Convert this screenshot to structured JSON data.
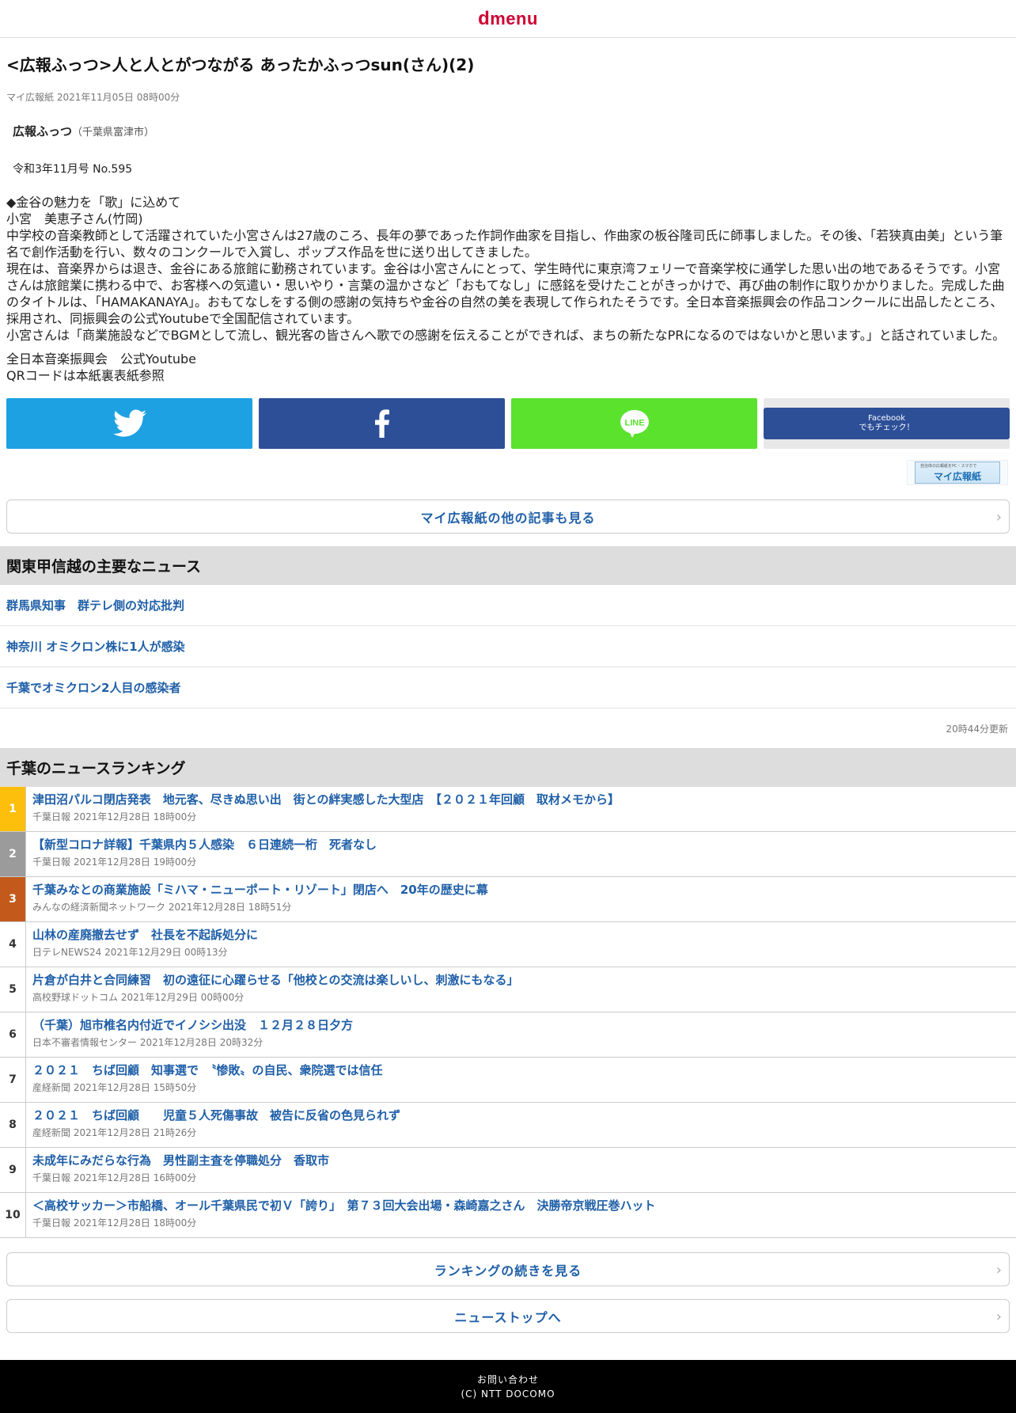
{
  "header": {
    "logo_d": "d",
    "logo_text": "menu"
  },
  "article": {
    "title": "<広報ふっつ>人と人とがつながる あったかふっつsun(さん)(2)",
    "meta": "マイ広報紙 2021年11月05日 08時00分",
    "source_name": "広報ふっつ",
    "source_place": "（千葉県富津市）",
    "issue": "令和3年11月号 No.595",
    "paragraphs": [
      "◆金谷の魅力を「歌」に込めて",
      "小宮　美恵子さん(竹岡)",
      "中学校の音楽教師として活躍されていた小宮さんは27歳のころ、長年の夢であった作詞作曲家を目指し、作曲家の板谷隆司氏に師事しました。その後、「若狭真由美」という筆名で創作活動を行い、数々のコンクールで入賞し、ポップス作品を世に送り出してきました。",
      "現在は、音楽界からは退き、金谷にある旅館に勤務されています。金谷は小宮さんにとって、学生時代に東京湾フェリーで音楽学校に通学した思い出の地であるそうです。小宮さんは旅館業に携わる中で、お客様への気遣い・思いやり・言葉の温かさなど「おもてなし」に感銘を受けたことがきっかけで、再び曲の制作に取りかかりました。完成した曲のタイトルは、「HAMAKANAYA」。おもてなしをする側の感謝の気持ちや金谷の自然の美を表現して作られたそうです。全日本音楽振興会の作品コンクールに出品したところ、採用され、同振興会の公式Youtubeで全国配信されています。",
      "小宮さんは「商業施設などでBGMとして流し、観光客の皆さんへ歌での感謝を伝えることができれば、まちの新たなPRになるのではないかと思います。」と話されていました。"
    ],
    "footer_lines": [
      "全日本音楽振興会　公式Youtube",
      "QRコードは本紙裏表紙参照"
    ]
  },
  "share": {
    "twitter_icon": "twitter-bird-icon",
    "facebook_icon": "facebook-f-icon",
    "line_label": "LINE",
    "fb_check_line1": "Facebook",
    "fb_check_line2": "でもチェック！"
  },
  "banner": {
    "tiny": "自治体の広報紙をPC・スマホで",
    "label": "マイ広報紙"
  },
  "more_button": "マイ広報紙の他の記事も見る",
  "regional": {
    "heading": "関東甲信越の主要なニュース",
    "items": [
      "群馬県知事　群テレ側の対応批判",
      "神奈川 オミクロン株に1人が感染",
      "千葉でオミクロン2人目の感染者"
    ],
    "updated": "20時44分更新"
  },
  "ranking": {
    "heading": "千葉のニュースランキング",
    "items": [
      {
        "rank": "1",
        "title": "津田沼パルコ閉店発表　地元客、尽きぬ思い出　街との絆実感した大型店　【２０２１年回顧　取材メモから】",
        "source": "千葉日報 2021年12月28日 18時00分"
      },
      {
        "rank": "2",
        "title": "【新型コロナ詳報】千葉県内５人感染　６日連続一桁　死者なし",
        "source": "千葉日報 2021年12月28日 19時00分"
      },
      {
        "rank": "3",
        "title": "千葉みなとの商業施設「ミハマ・ニューポート・リゾート」閉店へ　20年の歴史に幕",
        "source": "みんなの経済新聞ネットワーク 2021年12月28日 18時51分"
      },
      {
        "rank": "4",
        "title": "山林の産廃撤去せず　社長を不起訴処分に",
        "source": "日テレNEWS24 2021年12月29日 00時13分"
      },
      {
        "rank": "5",
        "title": "片倉が白井と合同練習　初の遠征に心躍らせる「他校との交流は楽しいし、刺激にもなる」",
        "source": "高校野球ドットコム 2021年12月29日 00時00分"
      },
      {
        "rank": "6",
        "title": "（千葉）旭市椎名内付近でイノシシ出没　１２月２８日夕方",
        "source": "日本不審者情報センター 2021年12月28日 20時32分"
      },
      {
        "rank": "7",
        "title": "２０２１　ちば回顧　知事選で　〝惨敗〟の自民、衆院選では信任",
        "source": "産経新聞 2021年12月28日 15時50分"
      },
      {
        "rank": "8",
        "title": "２０２１　ちば回顧　　児童５人死傷事故　被告に反省の色見られず",
        "source": "産経新聞 2021年12月28日 21時26分"
      },
      {
        "rank": "9",
        "title": "未成年にみだらな行為　男性副主査を停職処分　香取市",
        "source": "千葉日報 2021年12月28日 16時00分"
      },
      {
        "rank": "10",
        "title": "＜高校サッカー＞市船橋、オール千葉県民で初Ｖ「誇り」　第７３回大会出場・森崎嘉之さん　決勝帝京戦圧巻ハット",
        "source": "千葉日報 2021年12月28日 18時00分"
      }
    ],
    "more": "ランキングの続きを見る"
  },
  "news_top": "ニューストップへ",
  "footer": {
    "contact": "お問い合わせ",
    "copyright": "(C) NTT DOCOMO"
  }
}
